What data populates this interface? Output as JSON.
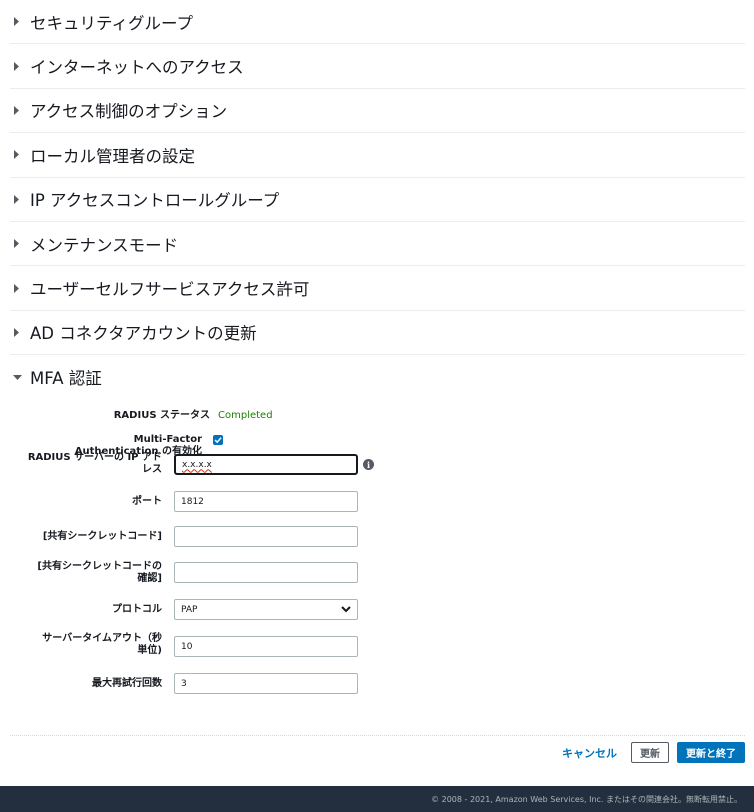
{
  "sections": [
    {
      "title": "セキュリティグループ",
      "expanded": false
    },
    {
      "title": "インターネットへのアクセス",
      "expanded": false
    },
    {
      "title": "アクセス制御のオプション",
      "expanded": false
    },
    {
      "title": "ローカル管理者の設定",
      "expanded": false
    },
    {
      "title": "IP アクセスコントロールグループ",
      "expanded": false
    },
    {
      "title": "メンテナンスモード",
      "expanded": false
    },
    {
      "title": "ユーザーセルフサービスアクセス許可",
      "expanded": false
    },
    {
      "title": "AD コネクタアカウントの更新",
      "expanded": false
    },
    {
      "title": "MFA 認証",
      "expanded": true
    }
  ],
  "mfa": {
    "radius_status_label": "RADIUS ステータス",
    "radius_status_value": "Completed",
    "mfa_enable_label": "Multi-Factor Authentication の有効化",
    "mfa_enabled": true,
    "server_ip_label_1": "RADIUS サーバーの IP アド",
    "server_ip_label_2": "レス",
    "server_ip_value": "x.x.x.x",
    "port_label": "ポート",
    "port_value": "1812",
    "secret_label": "[共有シークレットコード]",
    "secret_value": "",
    "secret_confirm_label_1": "[共有シークレットコードの",
    "secret_confirm_label_2": "確認]",
    "secret_confirm_value": "",
    "protocol_label": "プロトコル",
    "protocol_value": "PAP",
    "timeout_label_1": "サーバータイムアウト（秒",
    "timeout_label_2": "単位)",
    "timeout_value": "10",
    "retries_label": "最大再試行回数",
    "retries_value": "3"
  },
  "actions": {
    "cancel_label": "キャンセル",
    "update_label": "更新",
    "update_close_label": "更新と終了"
  },
  "footer": {
    "copyright": "© 2008 - 2021, Amazon Web Services, Inc. またはその関連会社。無断転用禁止。"
  },
  "colors": {
    "link_blue": "#0073bb",
    "status_green": "#1d8102",
    "footer_bg": "#232f3e"
  }
}
